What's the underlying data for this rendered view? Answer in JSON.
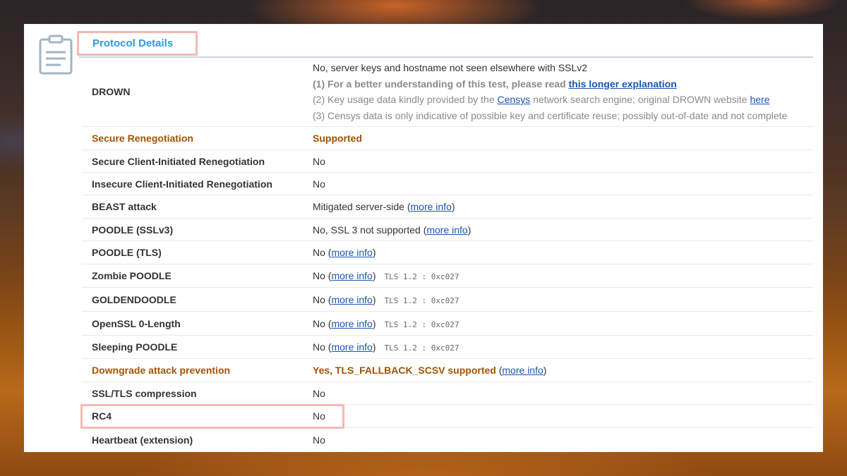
{
  "section": {
    "title": "Protocol Details",
    "icon": "clipboard-icon"
  },
  "drown": {
    "label": "DROWN",
    "main": "No, server keys and hostname not seen elsewhere with SSLv2",
    "note1_text": "(1) For a better understanding of this test, please read ",
    "note1_link": "this longer explanation",
    "note2_text": "(2) Key usage data kindly provided by the ",
    "note2_link1": "Censys",
    "note2_mid": " network search engine; original DROWN website ",
    "note2_link2": "here",
    "note3_text": "(3) Censys data is only indicative of possible key and certificate reuse; possibly out-of-date and not complete"
  },
  "rows": [
    {
      "label": "Secure Renegotiation",
      "value": "Supported",
      "highlight": true
    },
    {
      "label": "Secure Client-Initiated Renegotiation",
      "value": "No"
    },
    {
      "label": "Insecure Client-Initiated Renegotiation",
      "value": "No"
    },
    {
      "label": "BEAST attack",
      "value": "Mitigated server-side (",
      "link": "more info",
      "suffix": ")"
    },
    {
      "label": "POODLE (SSLv3)",
      "value": "No, SSL 3 not supported (",
      "link": "more info",
      "suffix": ")"
    },
    {
      "label": "POODLE (TLS)",
      "value": "No (",
      "link": "more info",
      "suffix": ")"
    },
    {
      "label": "Zombie POODLE",
      "value": "No (",
      "link": "more info",
      "suffix": ")",
      "tech": "TLS 1.2 : 0xc027"
    },
    {
      "label": "GOLDENDOODLE",
      "value": "No (",
      "link": "more info",
      "suffix": ")",
      "tech": "TLS 1.2 : 0xc027"
    },
    {
      "label": "OpenSSL 0-Length",
      "value": "No (",
      "link": "more info",
      "suffix": ")",
      "tech": "TLS 1.2 : 0xc027"
    },
    {
      "label": "Sleeping POODLE",
      "value": "No (",
      "link": "more info",
      "suffix": ")",
      "tech": "TLS 1.2 : 0xc027"
    },
    {
      "label": "Downgrade attack prevention",
      "value": "Yes, TLS_FALLBACK_SCSV supported",
      "open": " (",
      "link": "more info",
      "suffix": ")",
      "highlight": true
    },
    {
      "label": "SSL/TLS compression",
      "value": "No"
    },
    {
      "label": "RC4",
      "value": "No"
    },
    {
      "label": "Heartbeat (extension)",
      "value": "No"
    }
  ],
  "colors": {
    "accent": "#2f9ad6",
    "highlight_text": "#a35200",
    "link": "#1a55b4",
    "annotation_box": "#f6b9b2"
  }
}
